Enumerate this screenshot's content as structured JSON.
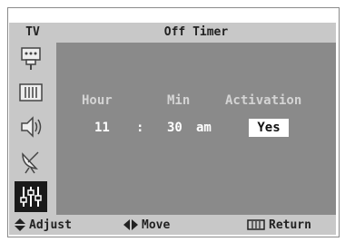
{
  "header": {
    "source_label": "TV",
    "title": "Off Timer"
  },
  "sidebar": {
    "items": [
      {
        "icon": "input-plug-icon"
      },
      {
        "icon": "picture-icon"
      },
      {
        "icon": "sound-icon"
      },
      {
        "icon": "channel-antenna-icon"
      },
      {
        "icon": "setup-sliders-icon",
        "active": true
      }
    ]
  },
  "timer": {
    "headers": {
      "hour": "Hour",
      "min": "Min",
      "activation": "Activation"
    },
    "hour": "11",
    "separator": ":",
    "min": "30",
    "ampm": "am",
    "activation": "Yes"
  },
  "footer": {
    "adjust": "Adjust",
    "move": "Move",
    "return": "Return"
  }
}
